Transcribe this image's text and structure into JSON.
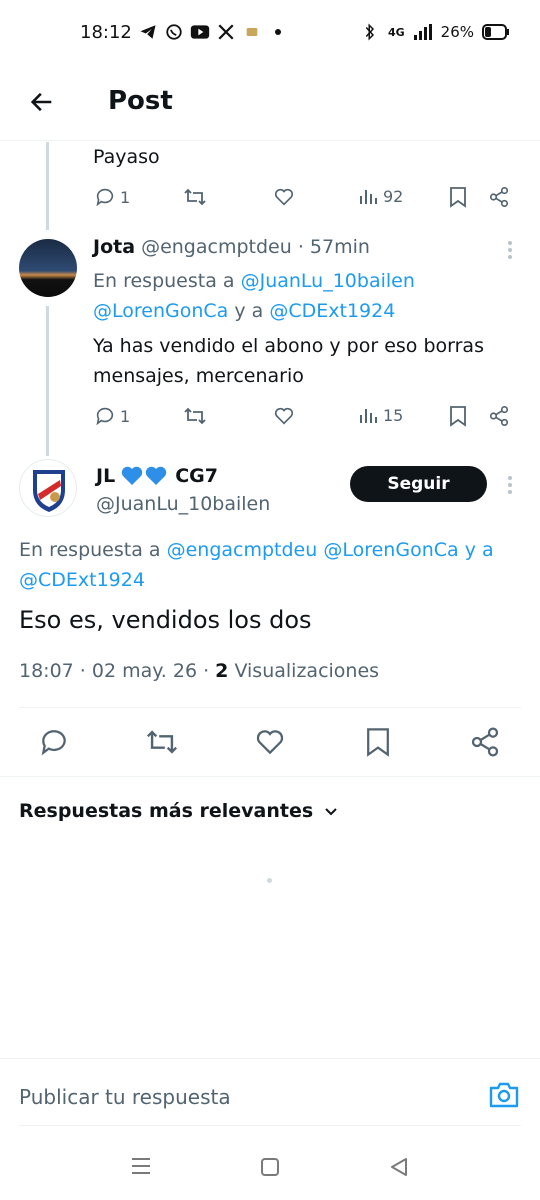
{
  "status_bar": {
    "time": "18:12",
    "network": "4G",
    "battery": "26%"
  },
  "header": {
    "title": "Post"
  },
  "prev_tweet": {
    "text": "Payaso",
    "replies": "1",
    "views": "92"
  },
  "reply1": {
    "name": "Jota",
    "handle": "@engacmptdeu",
    "time": "· 57min",
    "replying_prefix": "En respuesta a",
    "mention1": "@JuanLu_10bailen",
    "mention2": "@LorenGonCa",
    "and_word": "y a",
    "mention3": "@CDExt1924",
    "text_line1": "Ya has vendido el abono y por eso borras",
    "text_line2": "mensajes, mercenario",
    "replies": "1",
    "views": "15"
  },
  "main_tweet": {
    "name": "JL",
    "name_suffix": "CG7",
    "handle": "@JuanLu_10bailen",
    "follow_label": "Seguir",
    "replying_prefix": "En respuesta a",
    "mention1": "@engacmptdeu",
    "mention2": "@LorenGonCa",
    "and_word": "y a",
    "mention3": "@CDExt1924",
    "text": "Eso es, vendidos los dos",
    "timestamp": "18:07 · 02 may. 26 ·",
    "views_count": "2",
    "views_label": "Visualizaciones"
  },
  "replies_sort": {
    "label": "Respuestas más relevantes"
  },
  "compose": {
    "placeholder": "Publicar tu respuesta"
  },
  "colors": {
    "accent": "#1d9bf0",
    "text": "#0f1419",
    "muted": "#536471"
  }
}
